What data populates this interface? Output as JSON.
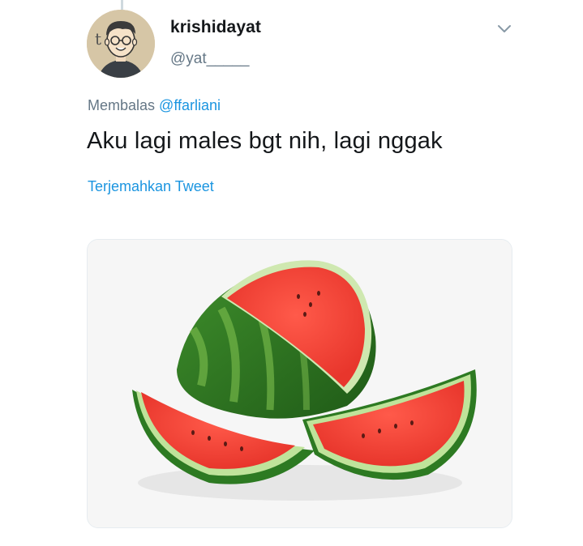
{
  "tweet": {
    "username": "krishidayat",
    "handle": "@yat_____",
    "reply_prefix": "Membalas",
    "reply_to": "@ffarliani",
    "text": "Aku lagi males bgt nih, lagi nggak",
    "translate_label": "Terjemahkan Tweet",
    "avatar_letter": "t"
  },
  "icons": {
    "caret": "chevron-down-icon"
  },
  "colors": {
    "link": "#1b95e0",
    "secondary_text": "#657786",
    "primary_text": "#14171a"
  }
}
